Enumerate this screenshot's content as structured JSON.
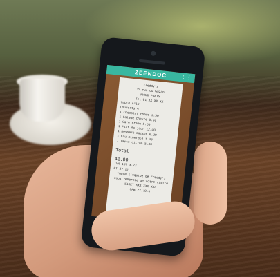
{
  "scene": {
    "description": "hand holding smartphone showing receipt scan app on a wooden table with coffee cup"
  },
  "app": {
    "name": "ZEENDOC",
    "menu_icon": "menu-icon"
  },
  "receipt": {
    "shop_name": "Freddy's",
    "address_1": "35 rue du Gazan",
    "address_2": "99000 PARIS",
    "phone": "Tel 01 XX XX XX",
    "table_label": "Table n°10",
    "guests": "Couverts 4",
    "lines": [
      "1 Chocolat chaud 3.50",
      "1 Salade chevre 8.90",
      "2 Cafe creme 5.60",
      "1 Plat du jour 12.40",
      "1 Dessert maison 6.20",
      "1 Eau minerale 3.00",
      "1 Tarte citron 5.80"
    ],
    "total_label": "Total",
    "total_value": "41.00",
    "tax_lines": [
      "TVA 10% 3.73",
      "HT 37.27"
    ],
    "footer_1": "Toute l'equipe de Freddy's",
    "footer_2": "vous remercie de votre visite",
    "footer_3": "SIRET XXX XXX XXX",
    "footer_4": "CAB 22.70.6"
  }
}
